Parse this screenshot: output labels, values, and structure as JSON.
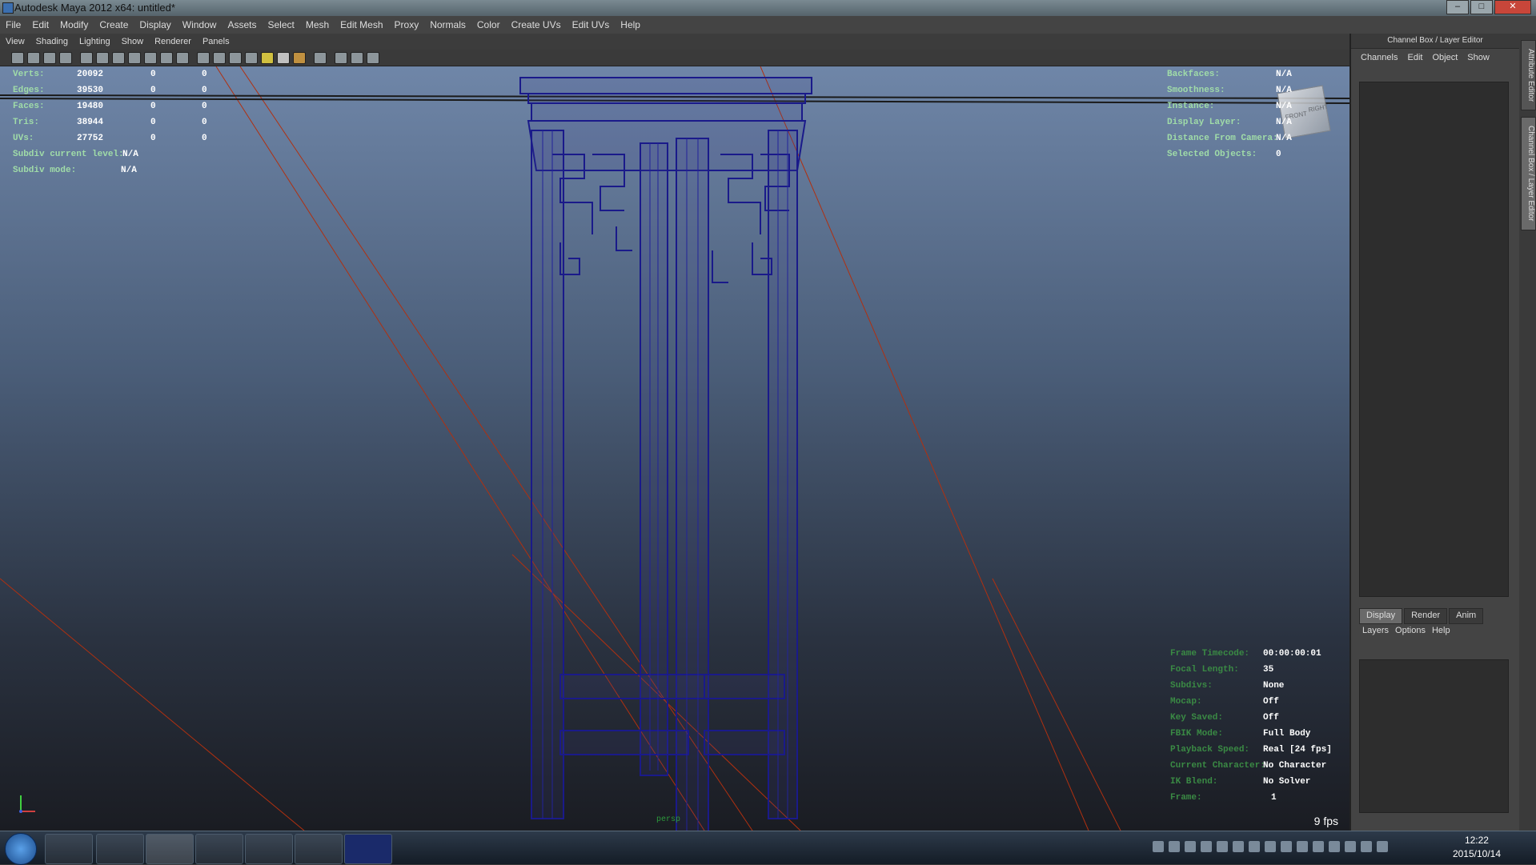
{
  "window": {
    "title": "Autodesk Maya 2012 x64: untitled*"
  },
  "main_menu": [
    "File",
    "Edit",
    "Modify",
    "Create",
    "Display",
    "Window",
    "Assets",
    "Select",
    "Mesh",
    "Edit Mesh",
    "Proxy",
    "Normals",
    "Color",
    "Create UVs",
    "Edit UVs",
    "Help"
  ],
  "viewport": {
    "menu": [
      "View",
      "Shading",
      "Lighting",
      "Show",
      "Renderer",
      "Panels"
    ],
    "poly_count": [
      {
        "label": "Verts:",
        "a": "20092",
        "b": "0",
        "c": "0"
      },
      {
        "label": "Edges:",
        "a": "39530",
        "b": "0",
        "c": "0"
      },
      {
        "label": "Faces:",
        "a": "19480",
        "b": "0",
        "c": "0"
      },
      {
        "label": "Tris:",
        "a": "38944",
        "b": "0",
        "c": "0"
      },
      {
        "label": "UVs:",
        "a": "27752",
        "b": "0",
        "c": "0"
      }
    ],
    "subdiv_current_level_label": "Subdiv current level:",
    "subdiv_current_level_value": "N/A",
    "subdiv_mode_label": "Subdiv mode:",
    "subdiv_mode_value": "N/A",
    "info_right": [
      {
        "label": "Backfaces:",
        "value": "N/A"
      },
      {
        "label": "Smoothness:",
        "value": "N/A"
      },
      {
        "label": "Instance:",
        "value": "N/A"
      },
      {
        "label": "Display Layer:",
        "value": "N/A"
      },
      {
        "label": "Distance From Camera:",
        "value": "N/A"
      },
      {
        "label": "Selected Objects:",
        "value": "0"
      }
    ],
    "info_bottom": [
      {
        "label": "Frame Timecode:",
        "value": "00:00:00:01"
      },
      {
        "label": "Focal Length:",
        "value": "35"
      },
      {
        "label": "Subdivs:",
        "value": "None"
      },
      {
        "label": "Mocap:",
        "value": "Off"
      },
      {
        "label": "Key Saved:",
        "value": "Off"
      },
      {
        "label": "FBIK Mode:",
        "value": "Full Body"
      },
      {
        "label": "Playback Speed:",
        "value": "Real [24 fps]"
      },
      {
        "label": "Current Character:",
        "value": "No Character"
      },
      {
        "label": "IK Blend:",
        "value": "No Solver"
      },
      {
        "label": "Frame:",
        "value": "1"
      }
    ],
    "fps": "9 fps",
    "camera_label": "persp",
    "view_cube_labels": [
      "FRONT",
      "RIGHT"
    ]
  },
  "channel_box": {
    "header": "Channel Box / Layer Editor",
    "menu": [
      "Channels",
      "Edit",
      "Object",
      "Show"
    ],
    "tabs": [
      "Display",
      "Render",
      "Anim"
    ],
    "active_tab": "Display",
    "layer_menu": [
      "Layers",
      "Options",
      "Help"
    ]
  },
  "side_tabs": [
    "Attribute Editor",
    "Channel Box / Layer Editor"
  ],
  "taskbar": {
    "time": "12:22",
    "date": "2015/10/14"
  },
  "colors": {
    "wireframe": "#1a1a8a",
    "grid_line": "#b03010",
    "hud_text": "#b8e8c8"
  }
}
